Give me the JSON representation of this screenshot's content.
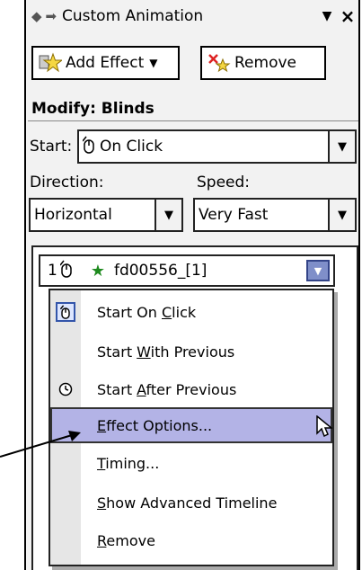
{
  "pane": {
    "title": "Custom Animation",
    "nav_back": "back-icon",
    "nav_forward": "forward-icon",
    "dropdown_glyph": "▼",
    "close_glyph": "×"
  },
  "toolbar": {
    "add_effect_label": "Add Effect",
    "add_effect_caret": "▼",
    "remove_label": "Remove"
  },
  "modify": {
    "heading": "Modify: Blinds",
    "start_label": "Start:",
    "start_value": "On Click",
    "direction_label": "Direction:",
    "direction_value": "Horizontal",
    "speed_label": "Speed:",
    "speed_value": "Very Fast"
  },
  "list": {
    "item_number": "1",
    "item_name": "fd00556_[1]"
  },
  "menu": {
    "items": [
      {
        "pre": "Start On ",
        "key": "C",
        "post": "lick",
        "icon": "mouse-icon"
      },
      {
        "pre": "Start ",
        "key": "W",
        "post": "ith Previous",
        "icon": ""
      },
      {
        "pre": "Start ",
        "key": "A",
        "post": "fter Previous",
        "icon": "clock-icon"
      },
      {
        "pre": "",
        "key": "E",
        "post": "ffect Options...",
        "icon": "",
        "highlighted": true
      },
      {
        "pre": "",
        "key": "T",
        "post": "iming...",
        "icon": ""
      },
      {
        "pre": "",
        "key": "S",
        "post": "how Advanced Timeline",
        "icon": ""
      },
      {
        "pre": "",
        "key": "R",
        "post": "emove",
        "icon": ""
      }
    ]
  },
  "colors": {
    "highlight": "#b3b3e6",
    "pane_bg": "#f2f2f2",
    "drop_button": "#7f8fc9"
  }
}
